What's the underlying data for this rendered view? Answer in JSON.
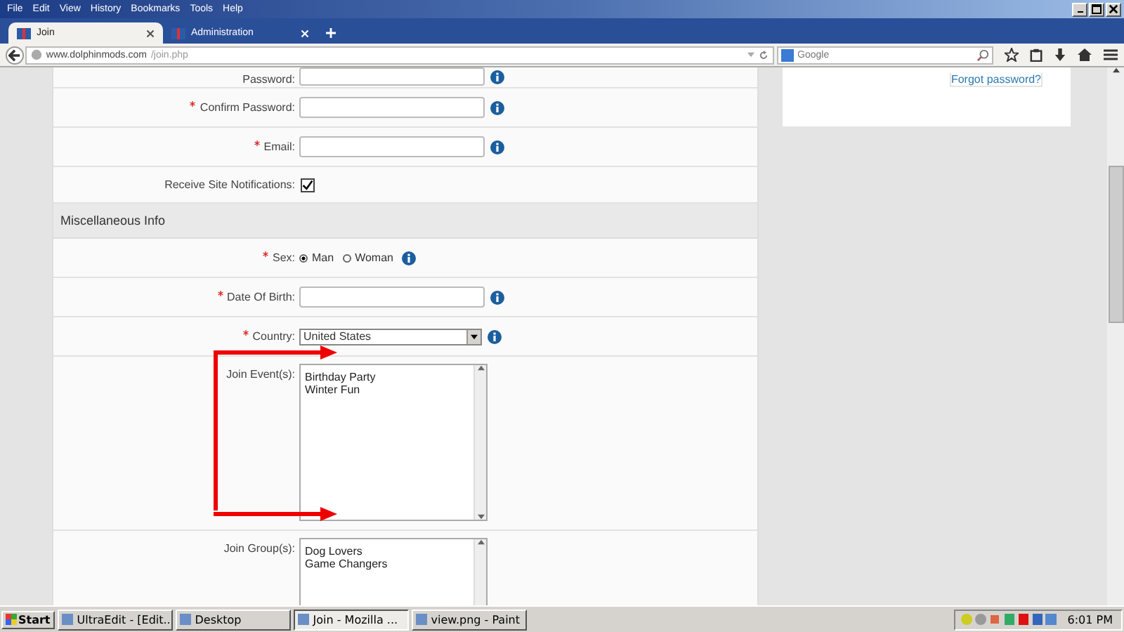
{
  "window": {
    "menu": [
      "File",
      "Edit",
      "View",
      "History",
      "Bookmarks",
      "Tools",
      "Help"
    ]
  },
  "tabs": [
    {
      "label": "Join",
      "selected": true
    },
    {
      "label": "Administration",
      "selected": false
    }
  ],
  "address_bar": {
    "url_domain": "www.dolphinmods.com",
    "url_path": "/join.php"
  },
  "search": {
    "placeholder": "Google"
  },
  "sidebar": {
    "link": "Forgot password?"
  },
  "form": {
    "rows": [
      {
        "kind": "input",
        "label": "Password:",
        "required": false,
        "info": true
      },
      {
        "kind": "input",
        "label": "Confirm Password:",
        "required": true,
        "info": true
      },
      {
        "kind": "input",
        "label": "Email:",
        "required": true,
        "info": true
      },
      {
        "kind": "checkbox",
        "label": "Receive Site Notifications:",
        "required": false,
        "checked": true,
        "info": false
      },
      {
        "kind": "section",
        "label": "Miscellaneous Info"
      },
      {
        "kind": "radio",
        "label": "Sex:",
        "required": true,
        "info": true,
        "options": [
          {
            "label": "Man",
            "selected": true
          },
          {
            "label": "Woman",
            "selected": false
          }
        ]
      },
      {
        "kind": "input",
        "label": "Date Of Birth:",
        "required": true,
        "info": true
      },
      {
        "kind": "select",
        "label": "Country:",
        "required": true,
        "info": true,
        "value": "United States"
      },
      {
        "kind": "listbox",
        "label": "Join Event(s):",
        "required": false,
        "info": false,
        "items": [
          "Birthday Party",
          "Winter Fun"
        ]
      },
      {
        "kind": "listbox",
        "label": "Join Group(s):",
        "required": false,
        "info": false,
        "items": [
          "Dog Lovers",
          "Game Changers"
        ]
      }
    ]
  },
  "taskbar": {
    "start": "Start",
    "items": [
      {
        "label": "UltraEdit - [Edit...",
        "selected": false
      },
      {
        "label": "Desktop",
        "selected": false
      },
      {
        "label": "Join - Mozilla ...",
        "selected": true
      },
      {
        "label": "view.png - Paint",
        "selected": false
      }
    ],
    "clock": "6:01 PM"
  }
}
